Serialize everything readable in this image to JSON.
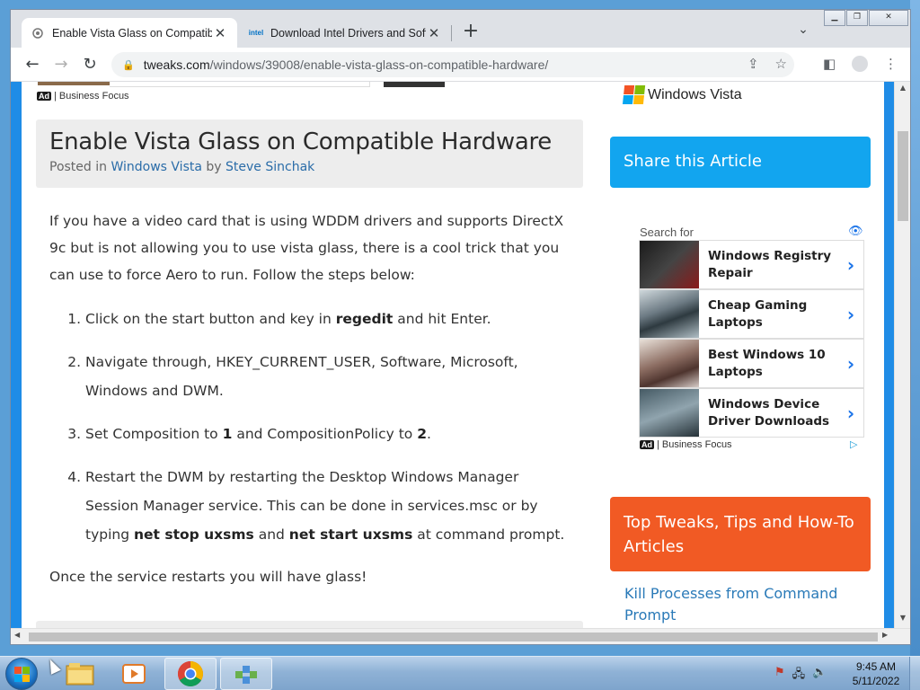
{
  "browser": {
    "tabs": [
      {
        "title": "Enable Vista Glass on Compatible",
        "favicon": "tweaks-favicon"
      },
      {
        "title": "Download Intel Drivers and Softw",
        "favicon": "intel-favicon",
        "favicon_text": "intel"
      }
    ],
    "address": {
      "host": "tweaks.com",
      "path": "/windows/39008/enable-vista-glass-on-compatible-hardware/"
    },
    "window_controls": [
      "minimize-icon",
      "restore-icon",
      "close-icon"
    ]
  },
  "page": {
    "top_ad": {
      "badge": "Ad",
      "source": "| Business Focus"
    },
    "logo_text": "Windows Vista",
    "title": "Enable Vista Glass on Compatible Hardware",
    "meta": {
      "prefix": "Posted in ",
      "category": "Windows Vista",
      "by": " by ",
      "author": "Steve Sinchak"
    },
    "intro": "If you have a video card that is using WDDM drivers and supports DirectX 9c but is not allowing you to use vista glass, there is a cool trick that you can use to force Aero to run. Follow the steps below:",
    "steps": {
      "s1": {
        "a": "Click on the start button and key in ",
        "b": "regedit",
        "c": " and hit Enter."
      },
      "s2": {
        "a": "Navigate through, HKEY_CURRENT_USER, Software, Microsoft, Windows and DWM."
      },
      "s3": {
        "a": "Set Composition to ",
        "b": "1",
        "c": " and CompositionPolicy to ",
        "d": "2",
        "e": "."
      },
      "s4": {
        "a": "Restart the DWM by restarting the Desktop Windows Manager Session Manager service. This can be done in services.msc or by typing ",
        "b": "net stop uxsms",
        "c": " and ",
        "d": "net start uxsms",
        "e": " at command prompt."
      }
    },
    "outro": "Once the service restarts you will have glass!"
  },
  "sidebar": {
    "share_title": "Share this Article",
    "search_for": "Search for",
    "ads": [
      {
        "label": "Windows Registry Repair"
      },
      {
        "label": "Cheap Gaming Laptops"
      },
      {
        "label": "Best Windows 10 Laptops"
      },
      {
        "label": "Windows Device Driver Downloads"
      }
    ],
    "ad_badge": "Ad",
    "ad_source": "| Business Focus",
    "top_title": "Top Tweaks, Tips and How-To Articles",
    "first_link": "Kill Processes from Command Prompt"
  },
  "taskbar": {
    "items": [
      "windows-explorer",
      "media-player",
      "google-chrome",
      "network-app"
    ],
    "time": "9:45 AM",
    "date": "5/11/2022"
  },
  "colors": {
    "share_blue": "#12a5ef",
    "top_orange": "#f15a24",
    "link_blue": "#2a6ca8",
    "frame_blue": "#1f8ce6"
  }
}
